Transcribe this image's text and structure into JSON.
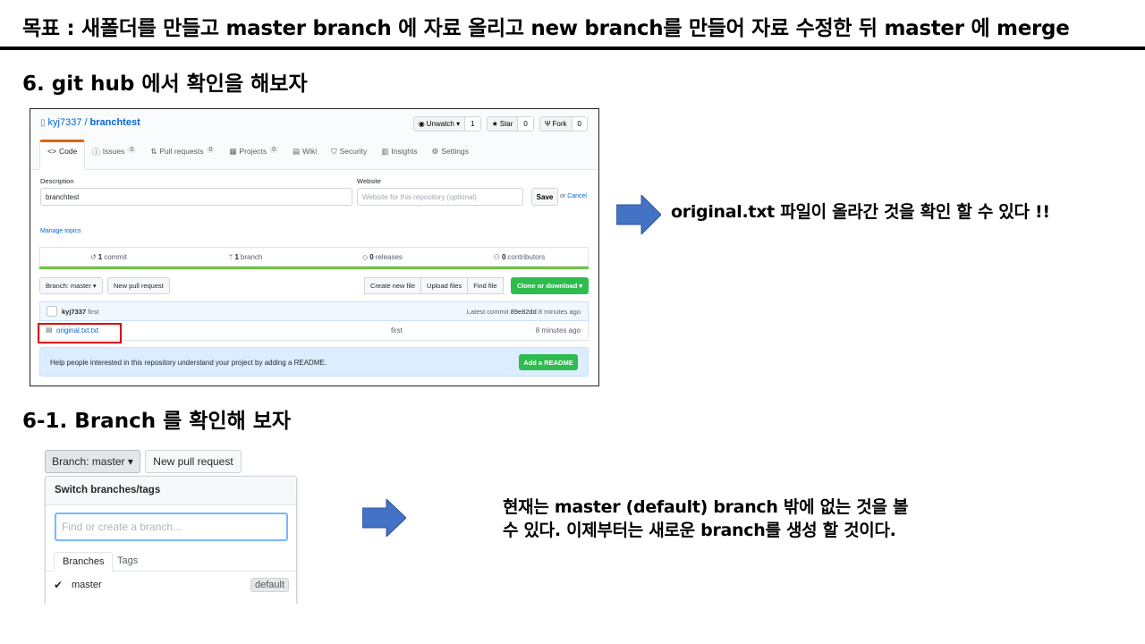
{
  "header": {
    "title": "목표 : 새폴더를 만들고 master branch 에 자료 올리고 new branch를 만들어 자료 수정한 뒤 master 에 merge"
  },
  "section1": {
    "heading": "6. git hub 에서 확인을 해보자",
    "note": "original.txt  파일이  올라간  것을  확인  할  수  있다  !!"
  },
  "section2": {
    "heading": "6-1. Branch 를 확인해 보자",
    "note_line1": "현재는 master (default) branch 밖에 없는 것을 볼",
    "note_line2": "수 있다. 이제부터는 새로운 branch를 생성 할 것이다."
  },
  "github": {
    "owner": "kyj7337",
    "separator": "/",
    "repo": "branchtest",
    "buttons": [
      {
        "label": "Unwatch ▾",
        "count": "1",
        "icon": "eye-icon"
      },
      {
        "label": "Star",
        "count": "0",
        "icon": "star-icon"
      },
      {
        "label": "Fork",
        "count": "0",
        "icon": "fork-icon"
      }
    ],
    "tabs": [
      {
        "label": "Code",
        "count": "",
        "icon": "code-icon"
      },
      {
        "label": "Issues",
        "count": "0",
        "icon": "issue-icon"
      },
      {
        "label": "Pull requests",
        "count": "0",
        "icon": "pull-request-icon"
      },
      {
        "label": "Projects",
        "count": "0",
        "icon": "project-icon"
      },
      {
        "label": "Wiki",
        "count": "",
        "icon": "wiki-icon"
      },
      {
        "label": "Security",
        "count": "",
        "icon": "shield-icon"
      },
      {
        "label": "Insights",
        "count": "",
        "icon": "graph-icon"
      },
      {
        "label": "Settings",
        "count": "",
        "icon": "gear-icon"
      }
    ],
    "description_label": "Description",
    "description_value": "branchtest",
    "website_label": "Website",
    "website_placeholder": "Website for this repository (optional)",
    "save_label": "Save",
    "or_label": "or",
    "cancel_label": "Cancel",
    "manage_topics": "Manage topics",
    "stats": [
      {
        "num": "1",
        "label": "commit",
        "icon": "history-icon"
      },
      {
        "num": "1",
        "label": "branch",
        "icon": "branch-icon"
      },
      {
        "num": "0",
        "label": "releases",
        "icon": "tag-icon"
      },
      {
        "num": "0",
        "label": "contributors",
        "icon": "people-icon"
      }
    ],
    "branch_button": "Branch: master ▾",
    "new_pr": "New pull request",
    "create_file": "Create new file",
    "upload_files": "Upload files",
    "find_file": "Find file",
    "clone": "Clone or download ▾",
    "commit_author": "kyj7337",
    "commit_msg": "first",
    "latest_label": "Latest commit",
    "latest_hash": "89e82dd",
    "latest_age": "8 minutes ago",
    "file": {
      "name": "original.txt.txt",
      "message": "first",
      "age": "8 minutes ago"
    },
    "readme_text": "Help people interested in this repository understand your project by adding a README.",
    "add_readme": "Add a README"
  },
  "branch_dropdown": {
    "button": "Branch: master",
    "new_pr": "New pull request",
    "header": "Switch branches/tags",
    "placeholder": "Find or create a branch...",
    "tabs": [
      "Branches",
      "Tags"
    ],
    "branch": "master",
    "badge": "default"
  },
  "colors": {
    "arrow": "#4472c4",
    "highlight": "#e00000",
    "green": "#2ebc4f",
    "link": "#0366d6"
  }
}
